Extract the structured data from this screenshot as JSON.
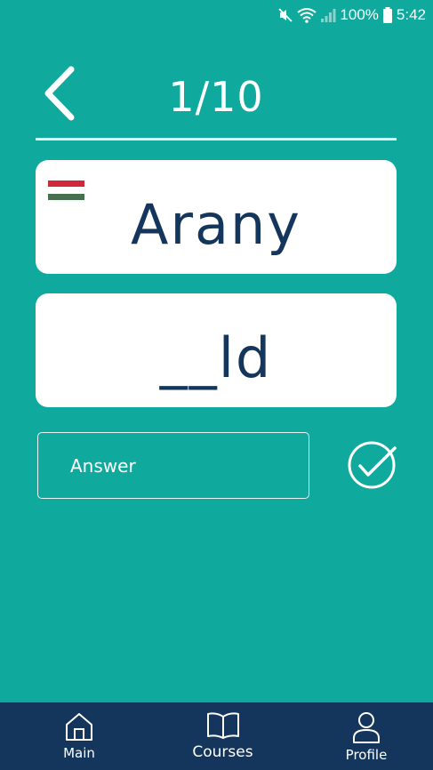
{
  "status_bar": {
    "battery_percent": "100%",
    "time": "5:42",
    "icons": [
      "mute-icon",
      "wifi-icon",
      "signal-icon",
      "battery-icon"
    ]
  },
  "header": {
    "counter": "1/10",
    "back_icon": "chevron-left-icon"
  },
  "word_card": {
    "flag": "hungary-flag",
    "flag_colors": [
      "#ce2939",
      "#ffffff",
      "#477050"
    ],
    "word": "Arany"
  },
  "hint_card": {
    "text": "__ld"
  },
  "answer": {
    "placeholder": "Answer",
    "value": "",
    "submit_icon": "check-circle-icon"
  },
  "bottom_nav": {
    "items": [
      {
        "label": "Main",
        "icon": "home-icon"
      },
      {
        "label": "Courses",
        "icon": "book-icon",
        "active": true
      },
      {
        "label": "Profile",
        "icon": "user-icon"
      }
    ]
  },
  "colors": {
    "background": "#0fa99d",
    "nav_background": "#14365c",
    "card_text": "#14365c",
    "card_background": "#ffffff"
  }
}
